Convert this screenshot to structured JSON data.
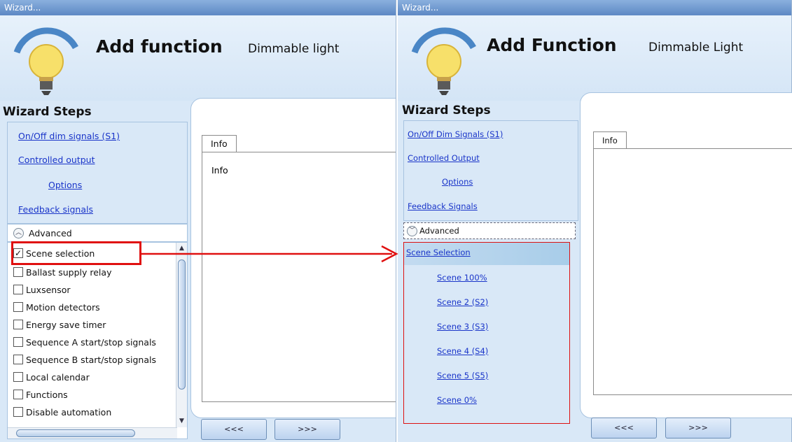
{
  "left": {
    "titlebar": "Wizard...",
    "title": "Add function",
    "subtitle": "Dimmable light",
    "steps_title": "Wizard Steps",
    "steps": [
      "On/Off dim signals (S1)",
      "Controlled output",
      "Options",
      "Feedback signals"
    ],
    "advanced_label": "Advanced",
    "checklist": [
      {
        "label": "Scene selection",
        "checked": "✓"
      },
      {
        "label": "Ballast supply relay",
        "checked": ""
      },
      {
        "label": "Luxsensor",
        "checked": ""
      },
      {
        "label": "Motion detectors",
        "checked": ""
      },
      {
        "label": "Energy save timer",
        "checked": ""
      },
      {
        "label": "Sequence A start/stop signals",
        "checked": ""
      },
      {
        "label": "Sequence B start/stop signals",
        "checked": ""
      },
      {
        "label": "Local calendar",
        "checked": ""
      },
      {
        "label": "Functions",
        "checked": ""
      },
      {
        "label": "Disable automation",
        "checked": ""
      }
    ],
    "tab_label": "Info",
    "tab_content": "Info",
    "back_button": "<<<",
    "next_button": ">>>"
  },
  "right": {
    "titlebar": "Wizard...",
    "title": "Add Function",
    "subtitle": "Dimmable Light",
    "steps_title": "Wizard Steps",
    "steps": [
      "On/Off Dim Signals (S1)",
      "Controlled Output",
      "Options",
      "Feedback Signals"
    ],
    "advanced_label": "Advanced",
    "scene_selection": "Scene Selection",
    "scenes": [
      "Scene 100%",
      "Scene 2 (S2)",
      "Scene 3 (S3)",
      "Scene 4 (S4)",
      "Scene 5 (S5)",
      "Scene 0%"
    ],
    "tab_label": "Info",
    "back_button": "<<<",
    "next_button": ">>>"
  },
  "colors": {
    "link": "#1a35c9",
    "highlight": "#e01010",
    "panel_bg": "#d9e8f7",
    "titlebar": "#6f98cf"
  },
  "icons": [
    "lightbulb-icon",
    "chevron-up-icon",
    "chevron-down-icon",
    "checkbox-icon",
    "red-arrow-icon"
  ]
}
